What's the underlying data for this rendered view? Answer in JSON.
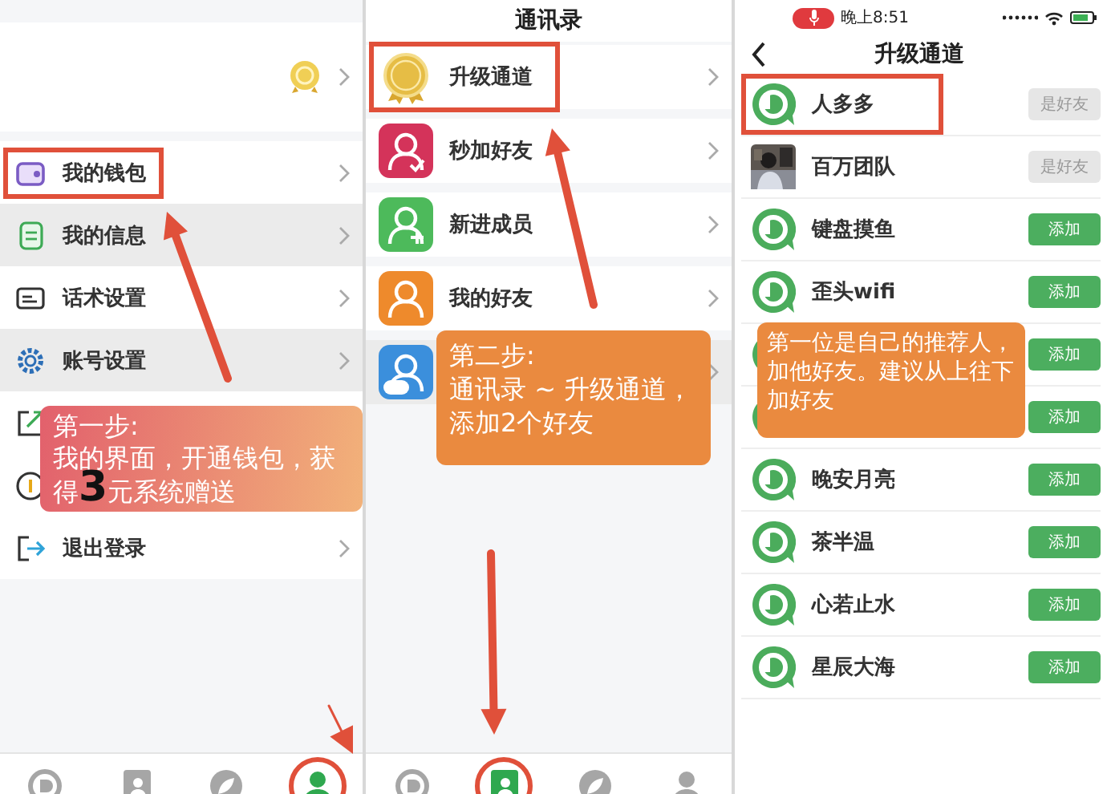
{
  "profile_screen": {
    "rows": [
      {
        "label": "我的钱包",
        "shaded": false,
        "highlighted": true
      },
      {
        "label": "我的信息",
        "shaded": true,
        "highlighted": false
      },
      {
        "label": "话术设置",
        "shaded": false,
        "highlighted": false
      },
      {
        "label": "账号设置",
        "shaded": true,
        "highlighted": false
      },
      {
        "shaded": false,
        "highlighted": false
      },
      {
        "shaded": false,
        "highlighted": false
      },
      {
        "label": "退出登录",
        "shaded": false,
        "highlighted": false
      }
    ],
    "note": {
      "lines": [
        "第一步:",
        "我的界面，开通钱包，获",
        "得**3**元系统赠送"
      ]
    },
    "tabs": [
      {
        "kind": "chat",
        "selected": false
      },
      {
        "kind": "contacts",
        "selected": false
      },
      {
        "kind": "discover",
        "selected": false
      },
      {
        "kind": "me",
        "selected": true
      }
    ]
  },
  "contacts_screen": {
    "title": "通讯录",
    "rows": [
      {
        "label": "升级通道",
        "color": "#e6bd45",
        "highlighted": true,
        "shaded": false
      },
      {
        "label": "秒加好友",
        "color": "#d4335a",
        "highlighted": false,
        "shaded": false
      },
      {
        "label": "新进成员",
        "color": "#4dba5b",
        "highlighted": false,
        "shaded": false
      },
      {
        "label": "我的好友",
        "color": "#ee8a2c",
        "highlighted": false,
        "shaded": false
      },
      {
        "color": "#3b8fdc",
        "highlighted": false,
        "shaded": true
      }
    ],
    "note": {
      "lines": [
        "第二步:",
        "通讯录 ~ 升级通道，",
        "添加2个好友"
      ]
    },
    "tabs": [
      {
        "kind": "chat",
        "selected": false
      },
      {
        "kind": "contacts",
        "selected": true
      },
      {
        "kind": "discover",
        "selected": false
      },
      {
        "kind": "me",
        "selected": false
      }
    ]
  },
  "upgrade_screen": {
    "status_time": "晚上8:51",
    "title": "升级通道",
    "contacts": [
      {
        "kind": "logo",
        "name": "人多多",
        "button": {
          "kind": "friend",
          "label": "是好友"
        },
        "highlighted": true
      },
      {
        "name": "百万团队",
        "button": {
          "kind": "friend",
          "label": "是好友"
        },
        "highlighted": false
      },
      {
        "kind": "logo",
        "name": "键盘摸鱼",
        "button": {
          "kind": "add",
          "label": "添加"
        },
        "highlighted": false
      },
      {
        "kind": "logo",
        "name": "歪头wifi",
        "button": {
          "kind": "add",
          "label": "添加"
        },
        "highlighted": false
      },
      {
        "kind": "logo",
        "button": {
          "kind": "add",
          "label": "添加"
        },
        "highlighted": false
      },
      {
        "kind": "logo",
        "button": {
          "kind": "add",
          "label": "添加"
        },
        "highlighted": false
      },
      {
        "kind": "logo",
        "name": "晚安月亮",
        "button": {
          "kind": "add",
          "label": "添加"
        },
        "highlighted": false
      },
      {
        "kind": "logo",
        "name": "茶半温",
        "button": {
          "kind": "add",
          "label": "添加"
        },
        "highlighted": false
      },
      {
        "kind": "logo",
        "name": "心若止水",
        "button": {
          "kind": "add",
          "label": "添加"
        },
        "highlighted": false
      },
      {
        "kind": "logo",
        "name": "星辰大海",
        "button": {
          "kind": "add",
          "label": "添加"
        },
        "highlighted": false
      }
    ],
    "note": {
      "lines": [
        "第一位是自己的推荐人，",
        "加他好友。建议从上往下",
        "加好友"
      ]
    }
  }
}
